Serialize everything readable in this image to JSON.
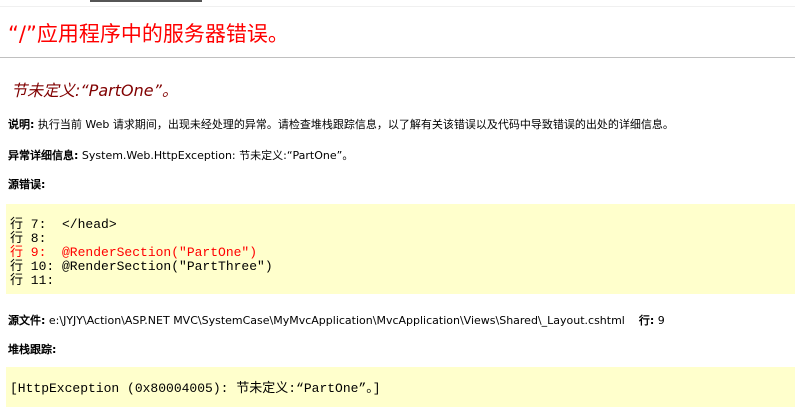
{
  "page": {
    "title": "“/”应用程序中的服务器错误。",
    "subtitle": "节未定义:“PartOne”。"
  },
  "description": {
    "label": "说明:",
    "text": " 执行当前 Web 请求期间，出现未经处理的异常。请检查堆栈跟踪信息，以了解有关该错误以及代码中导致错误的出处的详细信息。"
  },
  "exception": {
    "label": "异常详细信息:",
    "text": " System.Web.HttpException: 节未定义:“PartOne”。"
  },
  "source_error": {
    "label": "源错误:",
    "lines": [
      "行 7:  </head>",
      "行 8:",
      "行 9:  @RenderSection(\"PartOne\")",
      "行 10: @RenderSection(\"PartThree\")",
      "行 11:"
    ],
    "highlight_index": 2
  },
  "source_file": {
    "label": "源文件:",
    "path": " e:\\JYJY\\Action\\ASP.NET MVC\\SystemCase\\MyMvcApplication\\MvcApplication\\Views\\Shared\\_Layout.cshtml",
    "line_label": "行:",
    "line_number": " 9"
  },
  "stack_trace": {
    "label": "堆栈跟踪:",
    "first_line": "[HttpException (0x80004005): 节未定义:“PartOne”。]"
  },
  "colors": {
    "title": "#ff0000",
    "subtitle": "#800000",
    "code_background": "#ffffcc",
    "highlight": "#ff0000"
  }
}
